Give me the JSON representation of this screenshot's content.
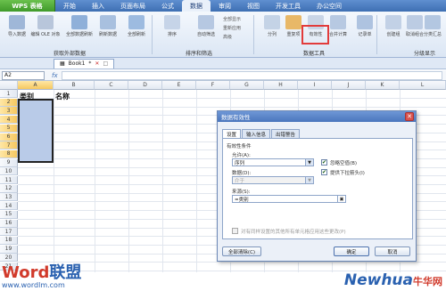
{
  "app": {
    "button_label": "WPS 表格"
  },
  "menu": {
    "tabs": [
      "开始",
      "插入",
      "页面布局",
      "公式",
      "数据",
      "审阅",
      "视图",
      "开发工具",
      "办公空间"
    ],
    "active_index": 4
  },
  "ribbon": {
    "buttons": [
      {
        "label": "导入数据",
        "icon": "import-data-icon"
      },
      {
        "label": "编辑 OLE 对象",
        "icon": "ole-edit-icon"
      },
      {
        "label": "全部数据刷新",
        "icon": "refresh-all-icon"
      },
      {
        "label": "刷新数据",
        "icon": "refresh-icon"
      },
      {
        "label": "全部刷新",
        "icon": "refresh-all-icon"
      },
      {
        "label": "排序",
        "icon": "sort-icon"
      },
      {
        "label": "自动筛选",
        "icon": "filter-icon"
      },
      {
        "label": "分列",
        "icon": "text-to-columns-icon"
      },
      {
        "label": "重复项",
        "icon": "duplicates-icon"
      },
      {
        "label": "有效性",
        "icon": "data-validation-icon"
      },
      {
        "label": "合并计算",
        "icon": "consolidate-icon"
      },
      {
        "label": "记录单",
        "icon": "record-form-icon"
      },
      {
        "label": "创建组",
        "icon": "group-icon"
      },
      {
        "label": "取消组合",
        "icon": "ungroup-icon"
      },
      {
        "label": "分类汇总",
        "icon": "subtotal-icon"
      }
    ],
    "small_items": [
      "全部显示",
      "重新应用",
      "高级"
    ],
    "groups": [
      "获取外部数据",
      "排序和筛选",
      "数据工具",
      "分级显示"
    ]
  },
  "doc_tab": {
    "name": "Book1",
    "modified_marker": "*"
  },
  "formula_bar": {
    "cell_ref": "A2",
    "fx": "fx",
    "formula": ""
  },
  "sheet": {
    "columns": [
      "A",
      "B",
      "C",
      "D",
      "E",
      "F",
      "G",
      "H",
      "I",
      "J",
      "K",
      "L"
    ],
    "rows": [
      "1",
      "2",
      "3",
      "4",
      "5",
      "6",
      "7",
      "8",
      "9",
      "10",
      "11",
      "12",
      "13",
      "14",
      "15",
      "16",
      "17",
      "18",
      "19",
      "20",
      "21"
    ],
    "cells": {
      "A1": "类别",
      "B1": "名称"
    }
  },
  "dialog": {
    "title": "数据有效性",
    "tabs": [
      "设置",
      "输入信息",
      "出错警告"
    ],
    "section": "有效性条件",
    "allow_label": "允许(A):",
    "allow_value": "序列",
    "data_label": "数据(D):",
    "data_value": "介于",
    "source_label": "来源(S):",
    "source_value": "=类别",
    "ignore_blank": "忽略空值(B)",
    "dropdown": "提供下拉箭头(I)",
    "apply_all": "对有同样设置的其他所有单元格应用这些更改(P)",
    "clear_all": "全部清除(C)",
    "ok": "确定",
    "cancel": "取消"
  },
  "watermark": {
    "left_brand_a": "Word",
    "left_brand_b": "联盟",
    "left_url": "www.wordlm.com",
    "right_brand": "Newhua",
    "right_cn": "牛华网"
  },
  "colors": {
    "menu_bar": "#3e6fb3",
    "selection": "#b9cbe8",
    "highlight": "#e23b3b",
    "dialog_title": "#4a76bd"
  }
}
